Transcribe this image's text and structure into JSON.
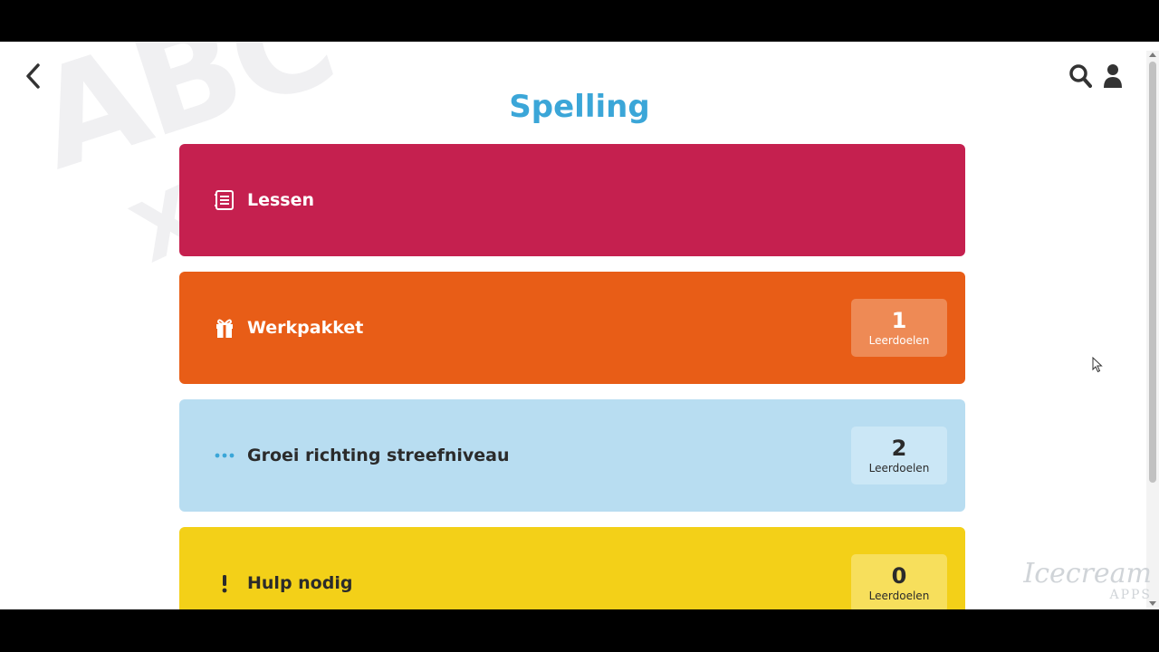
{
  "page": {
    "title": "Spelling",
    "background_letters": "ABC",
    "background_letters2": "X"
  },
  "nav": {
    "back_icon": "chevron-left-icon",
    "search_icon": "search-icon",
    "user_icon": "user-icon"
  },
  "cards": [
    {
      "label": "Lessen",
      "icon": "list-icon",
      "color": "#c5204f",
      "badge": null
    },
    {
      "label": "Werkpakket",
      "icon": "gift-icon",
      "color": "#e85d17",
      "badge": {
        "count": "1",
        "caption": "Leerdoelen"
      }
    },
    {
      "label": "Groei richting streefniveau",
      "icon": "dots-icon",
      "color": "#b8ddf1",
      "badge": {
        "count": "2",
        "caption": "Leerdoelen"
      }
    },
    {
      "label": "Hulp nodig",
      "icon": "exclamation-icon",
      "color": "#f3d018",
      "badge": {
        "count": "0",
        "caption": "Leerdoelen"
      }
    }
  ],
  "watermark": {
    "brand": "Icecream",
    "sub": "APPS"
  },
  "colors": {
    "title": "#3ba6d8"
  }
}
